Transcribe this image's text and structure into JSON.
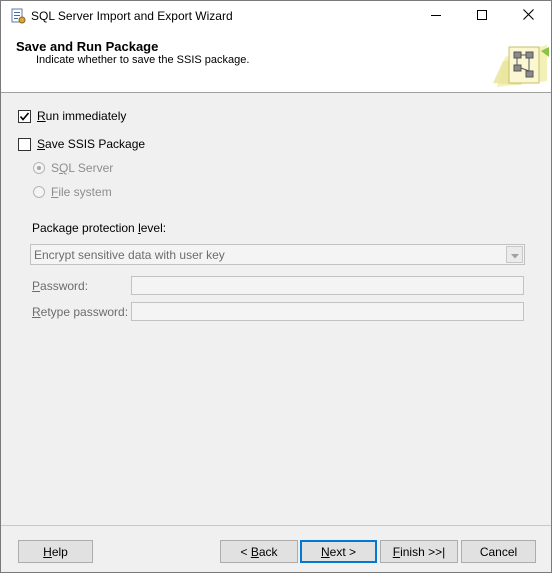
{
  "window": {
    "title": "SQL Server Import and Export Wizard"
  },
  "header": {
    "title": "Save and Run Package",
    "subtitle": "Indicate whether to save the SSIS package."
  },
  "options": {
    "run_immediately": {
      "label_prefix": "",
      "accel": "R",
      "label_rest": "un immediately",
      "checked": true
    },
    "save_package": {
      "accel": "S",
      "label_rest": "ave SSIS Package",
      "checked": false
    },
    "sql_server": {
      "accel": "Q",
      "label_pre": "S",
      "label_rest": "L Server",
      "selected": true
    },
    "file_system": {
      "accel": "F",
      "label_rest": "ile system",
      "selected": false
    }
  },
  "protection": {
    "label_pre": "Package protection ",
    "accel": "l",
    "label_rest": "evel:",
    "value": "Encrypt sensitive data with user key"
  },
  "password": {
    "accel": "P",
    "label_rest": "assword:",
    "value": ""
  },
  "retype": {
    "accel": "R",
    "label_rest": "etype password:",
    "value": ""
  },
  "buttons": {
    "help": {
      "accel": "H",
      "rest": "elp"
    },
    "back": {
      "pre": "< ",
      "accel": "B",
      "rest": "ack"
    },
    "next": {
      "accel": "N",
      "rest": "ext >"
    },
    "finish": {
      "accel": "F",
      "rest": "inish >>|"
    },
    "cancel": "Cancel"
  },
  "icons": {
    "app": "wizard-app-icon",
    "header": "package-graphic-icon",
    "minimize": "minimize-icon",
    "maximize": "maximize-icon",
    "close": "close-icon"
  },
  "colors": {
    "accent": "#0078d7",
    "disabled_text": "#6d6d6d"
  }
}
